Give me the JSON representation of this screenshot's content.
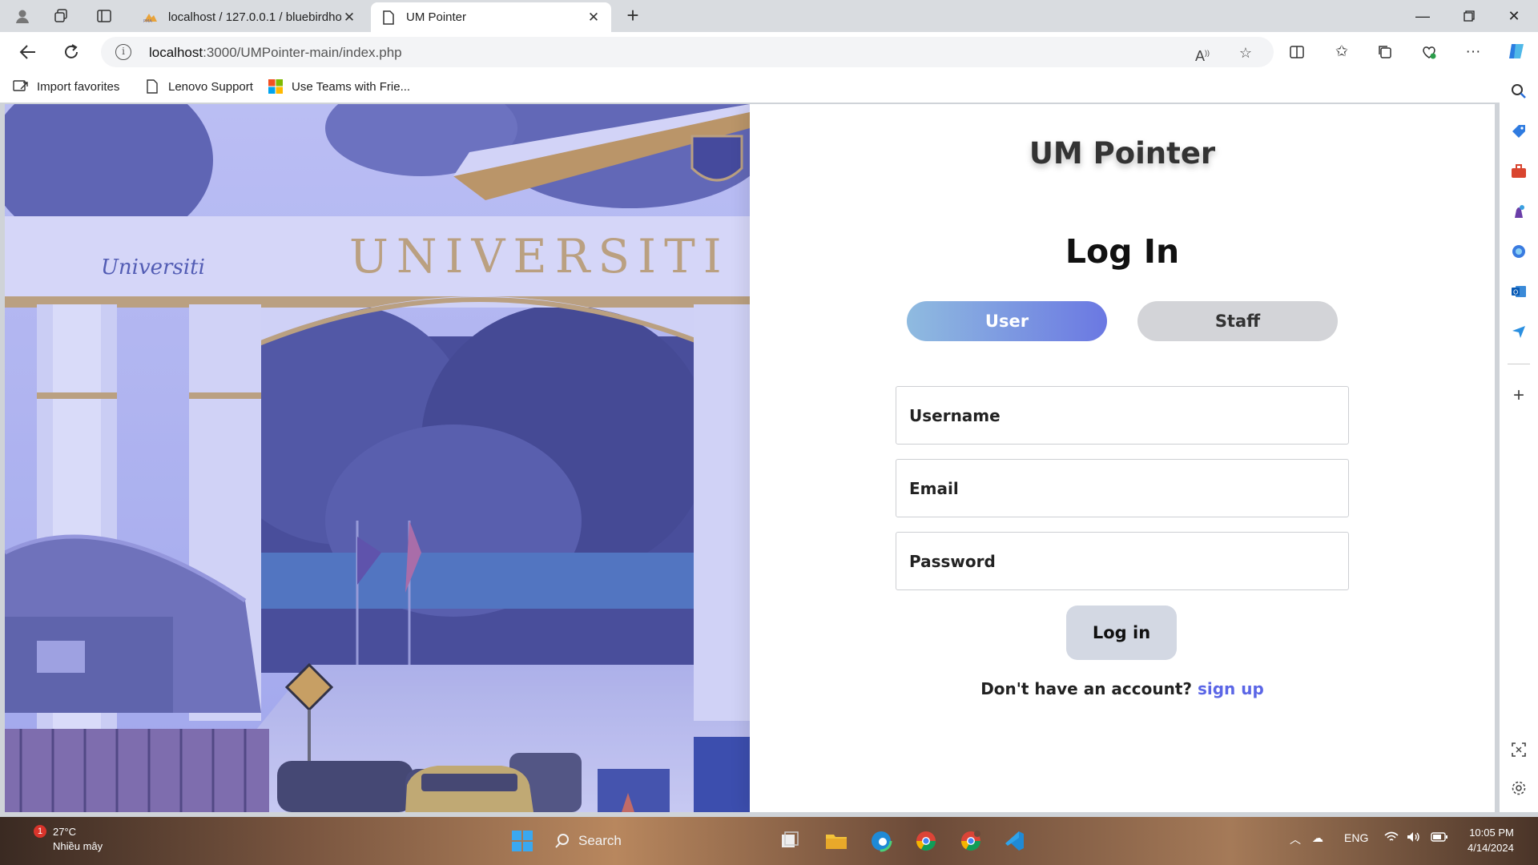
{
  "browser": {
    "tabs": [
      {
        "title": "localhost / 127.0.0.1 / bluebirdhotel",
        "favicon": "phpmyadmin-icon"
      },
      {
        "title": "UM Pointer",
        "favicon": "page-icon"
      }
    ],
    "address": {
      "host": "localhost",
      "path": ":3000/UMPointer-main/index.php"
    },
    "favorites": [
      {
        "label": "Import favorites",
        "icon": "import-icon"
      },
      {
        "label": "Lenovo Support",
        "icon": "page-icon"
      },
      {
        "label": "Use Teams with Frie...",
        "icon": "windows-logo-icon"
      }
    ]
  },
  "page": {
    "brand": "UM Pointer",
    "heading": "Log In",
    "toggle": {
      "user": "User",
      "staff": "Staff",
      "active": "User"
    },
    "fields": {
      "username": {
        "placeholder": "Username",
        "value": ""
      },
      "email": {
        "placeholder": "Email",
        "value": ""
      },
      "password": {
        "placeholder": "Password",
        "value": ""
      }
    },
    "login_button": "Log in",
    "signup_prompt": "Don't have an account?",
    "signup_link": "sign up",
    "photo": {
      "sign_text": "UNIVERSITI",
      "left_sign": "Universiti"
    }
  },
  "taskbar": {
    "weather": {
      "temp": "27°C",
      "condition": "Nhiều mây",
      "badge": "1"
    },
    "search_label": "Search",
    "tray": {
      "language": "ENG"
    },
    "clock": {
      "time": "10:05 PM",
      "date": "4/14/2024"
    }
  },
  "colors": {
    "accent": "#6b78e2",
    "link": "#5b66e6",
    "toggle_inactive": "#d3d4d8",
    "button": "#d3d8e3"
  }
}
